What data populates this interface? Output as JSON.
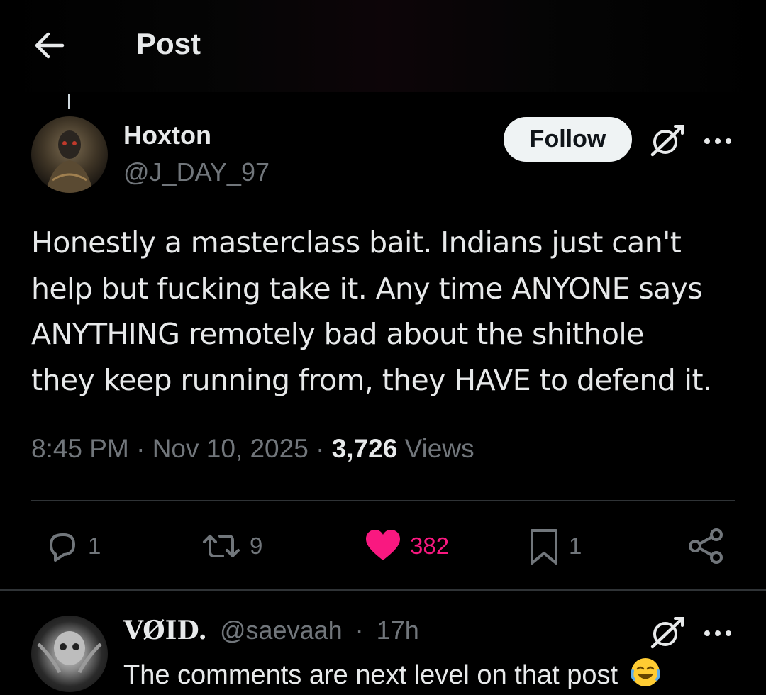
{
  "header": {
    "title": "Post",
    "back_icon": "arrow-left-icon"
  },
  "post": {
    "author": {
      "display_name": "Hoxton",
      "handle": "@J_DAY_97"
    },
    "follow_label": "Follow",
    "text": "Honestly a masterclass bait. Indians just can't\nhelp but fucking take it. Any time ANYONE says\nANYTHING remotely bad about the shithole\nthey keep running from, they HAVE to defend it.",
    "time": "8:45 PM",
    "date": "Nov 10, 2025",
    "separator": "·",
    "views_count": "3,726",
    "views_label": "Views",
    "actions": {
      "reply_count": "1",
      "repost_count": "9",
      "like_count": "382",
      "bookmark_count": "1"
    }
  },
  "reply": {
    "display_name": "VØID.",
    "handle": "@saevaah",
    "separator": "·",
    "age": "17h",
    "text": "The comments are next level on that post"
  },
  "colors": {
    "background": "#000000",
    "text_primary": "#e7e9ea",
    "text_secondary": "#71767b",
    "like_pink": "#f91880",
    "divider": "#2f3336",
    "follow_bg": "#eff3f4"
  }
}
